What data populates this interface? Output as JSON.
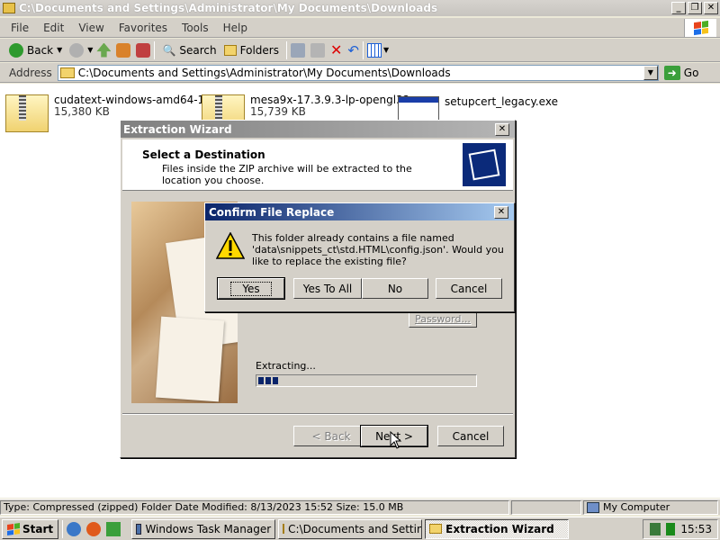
{
  "explorer": {
    "title": "C:\\Documents and Settings\\Administrator\\My Documents\\Downloads",
    "menu": [
      "File",
      "Edit",
      "View",
      "Favorites",
      "Tools",
      "Help"
    ],
    "toolbar": {
      "back": "Back",
      "search": "Search",
      "folders": "Folders"
    },
    "address_label": "Address",
    "address_value": "C:\\Documents and Settings\\Administrator\\My Documents\\Downloads",
    "go_label": "Go",
    "files": [
      {
        "name": "cudatext-windows-amd64-1.1...",
        "size": "15,380 KB",
        "icon": "zip-folder-icon"
      },
      {
        "name": "mesa9x-17.3.9.3-lp-opengl32...",
        "size": "15,739 KB",
        "icon": "zip-folder-icon"
      },
      {
        "name": "setupcert_legacy.exe",
        "size": "",
        "icon": "exe-window-icon"
      }
    ],
    "status_left": "Type: Compressed (zipped) Folder Date Modified: 8/13/2023 15:52 Size: 15.0 MB",
    "status_right": "My Computer"
  },
  "wizard": {
    "title": "Extraction Wizard",
    "header_title": "Select a Destination",
    "header_sub": "Files inside the ZIP archive will be extracted to the location you choose.",
    "password_label": "Password...",
    "extracting_label": "Extracting...",
    "progress_fraction": 0.1,
    "back_label": "< Back",
    "next_label": "Next >",
    "cancel_label": "Cancel"
  },
  "confirm": {
    "title": "Confirm File Replace",
    "message": "This folder already contains a file named 'data\\snippets_ct\\std.HTML\\config.json'.  Would you like to replace the existing file?",
    "yes": "Yes",
    "yes_all": "Yes To All",
    "no": "No",
    "cancel": "Cancel"
  },
  "taskbar": {
    "start": "Start",
    "items": [
      "Windows Task Manager",
      "C:\\Documents and Settin...",
      "Extraction Wizard"
    ],
    "time": "15:53"
  }
}
